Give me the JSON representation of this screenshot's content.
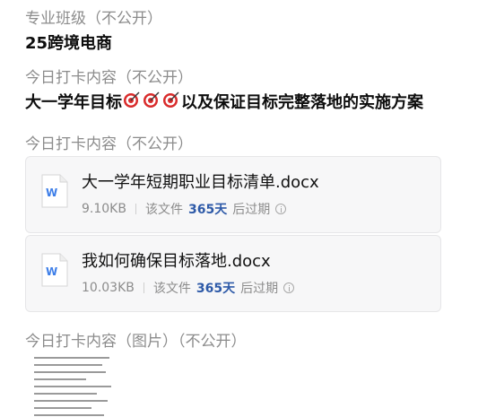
{
  "fields": [
    {
      "label": "专业班级（不公开）",
      "value": "25跨境电商"
    },
    {
      "label": "今日打卡内容（不公开）",
      "value_prefix": "大一学年目标",
      "value_suffix": "以及保证目标完整落地的实施方案"
    },
    {
      "label": "今日打卡内容（不公开）"
    },
    {
      "label": "今日打卡内容（图片）（不公开）"
    }
  ],
  "files": [
    {
      "name": "大一学年短期职业目标清单.docx",
      "size": "9.10KB",
      "prefix": "该文件",
      "days": "365天",
      "suffix": "后过期"
    },
    {
      "name": "我如何确保目标落地.docx",
      "size": "10.03KB",
      "prefix": "该文件",
      "days": "365天",
      "suffix": "后过期"
    }
  ],
  "icons": {
    "doc": "word-doc-icon",
    "target": "dart-target-emoji-icon",
    "info": "info-circle-icon"
  },
  "colors": {
    "accent_days": "#2e5aa8",
    "doc_icon": "#3d7ee8"
  }
}
